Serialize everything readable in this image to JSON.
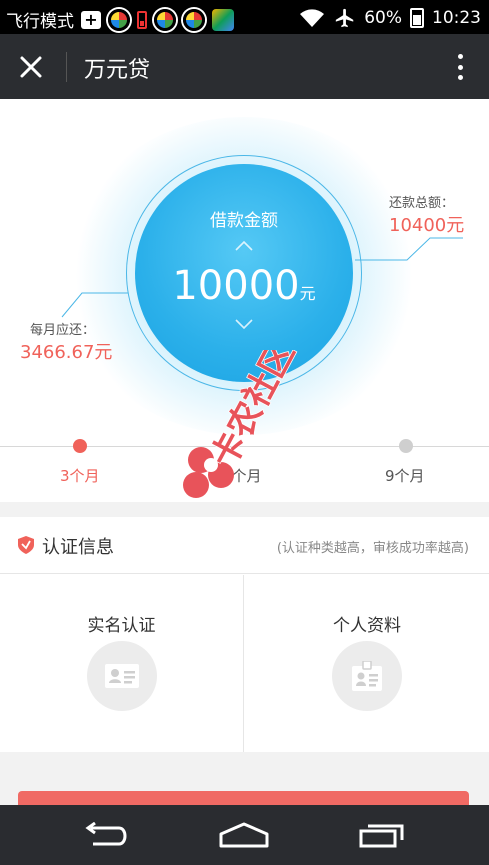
{
  "status_bar": {
    "airplane_mode_label": "飞行模式",
    "battery": "60%",
    "time": "10:23",
    "icons": [
      "plus-icon",
      "app-icon",
      "battery-low-icon",
      "app-icon",
      "app-icon",
      "app-icon",
      "wifi-icon",
      "airplane-icon",
      "battery-icon"
    ]
  },
  "header": {
    "title": "万元贷",
    "close_icon": "close-icon",
    "menu_icon": "more-vertical-icon"
  },
  "loan": {
    "amount_label": "借款金额",
    "amount": "10000",
    "amount_unit": "元",
    "monthly_label": "每月应还：",
    "monthly_value": "3466.67元",
    "total_label": "还款总额：",
    "total_value": "10400元"
  },
  "terms": {
    "items": [
      {
        "label": "3个月",
        "active": true
      },
      {
        "label": "6个月",
        "active": false
      },
      {
        "label": "9个月",
        "active": false
      }
    ]
  },
  "certification": {
    "title": "认证信息",
    "hint": "(认证种类越高，审核成功率越高)",
    "items": [
      {
        "label": "实名认证",
        "icon": "id-card-icon"
      },
      {
        "label": "个人资料",
        "icon": "profile-badge-icon"
      }
    ]
  },
  "watermark": {
    "text": "卡农社区"
  },
  "colors": {
    "accent": "#f0625a",
    "blue": "#2bb0ea",
    "appbar": "#2b2d31"
  }
}
